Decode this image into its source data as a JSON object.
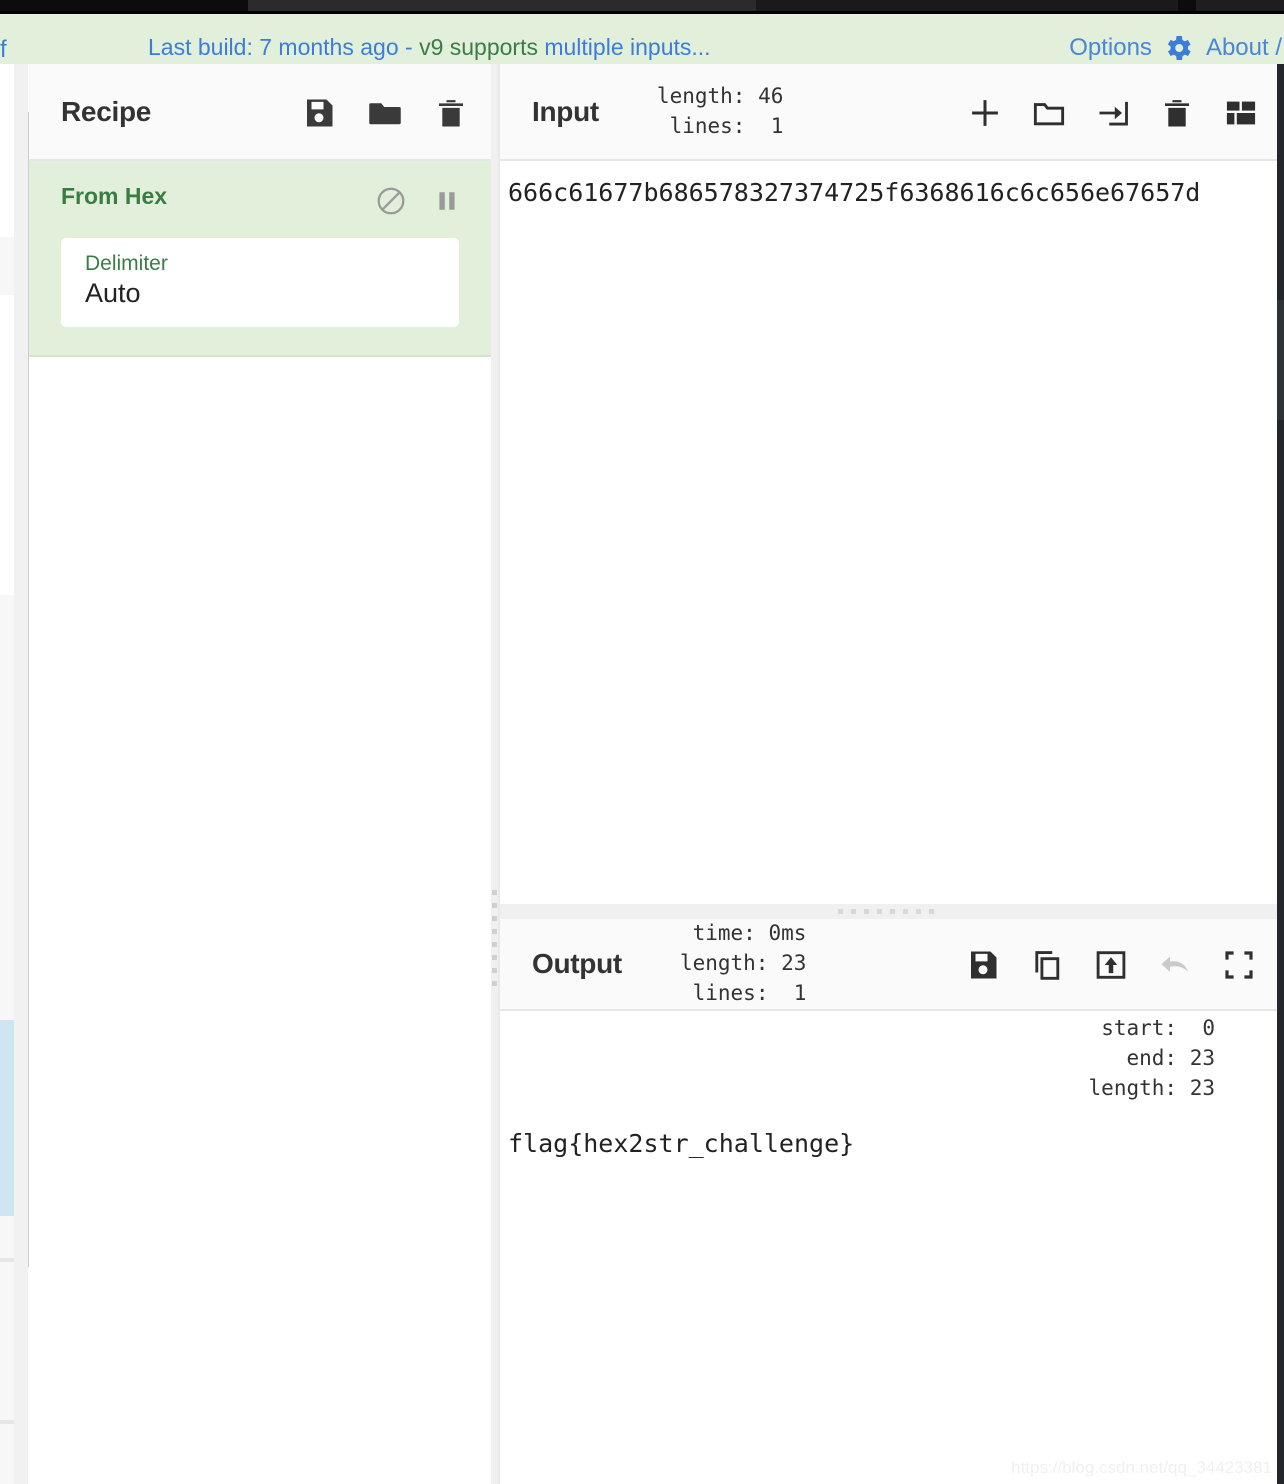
{
  "banner": {
    "left_fragment": "f",
    "message_blue_1": "Last build: 7 months ago - ",
    "message_green": "v9 supports ",
    "message_blue_2": "multiple inputs...",
    "options_label": "Options",
    "about_label": "About /",
    "gear_icon": "gear-icon",
    "background_color": "#e2efda",
    "link_color": "#4a86d8",
    "green_color": "#3a7d44"
  },
  "recipe": {
    "title": "Recipe",
    "icons": [
      "save-icon",
      "folder-icon",
      "trash-icon"
    ],
    "operations": [
      {
        "name": "From Hex",
        "disable_icon": "circle-slash-icon",
        "breakpoint_icon": "pause-icon",
        "args": [
          {
            "label": "Delimiter",
            "value": "Auto"
          }
        ]
      }
    ]
  },
  "input": {
    "title": "Input",
    "stats": {
      "length_label": "length:",
      "length_value": "46",
      "lines_label": "lines:",
      "lines_value": " 1"
    },
    "icons": [
      "add-tab-icon",
      "open-folder-icon",
      "open-input-icon",
      "clear-input-icon",
      "tab-layout-icon"
    ],
    "value": "666c61677b686578327374725f6368616c6c656e67657d"
  },
  "output": {
    "title": "Output",
    "stats": {
      "time_label": "time:",
      "time_value": "0ms",
      "length_label": "length:",
      "length_value": "23",
      "lines_label": "lines:",
      "lines_value": " 1"
    },
    "selection": {
      "start_label": "start:",
      "start_value": " 0",
      "end_label": "end:",
      "end_value": "23",
      "length_label": "length:",
      "length_value": "23"
    },
    "icons": [
      "save-output-icon",
      "copy-output-icon",
      "replace-input-icon",
      "undo-icon",
      "maximize-icon"
    ],
    "value": "flag{hex2str_challenge}"
  },
  "watermark": "https://blog.csdn.net/qq_34423381"
}
